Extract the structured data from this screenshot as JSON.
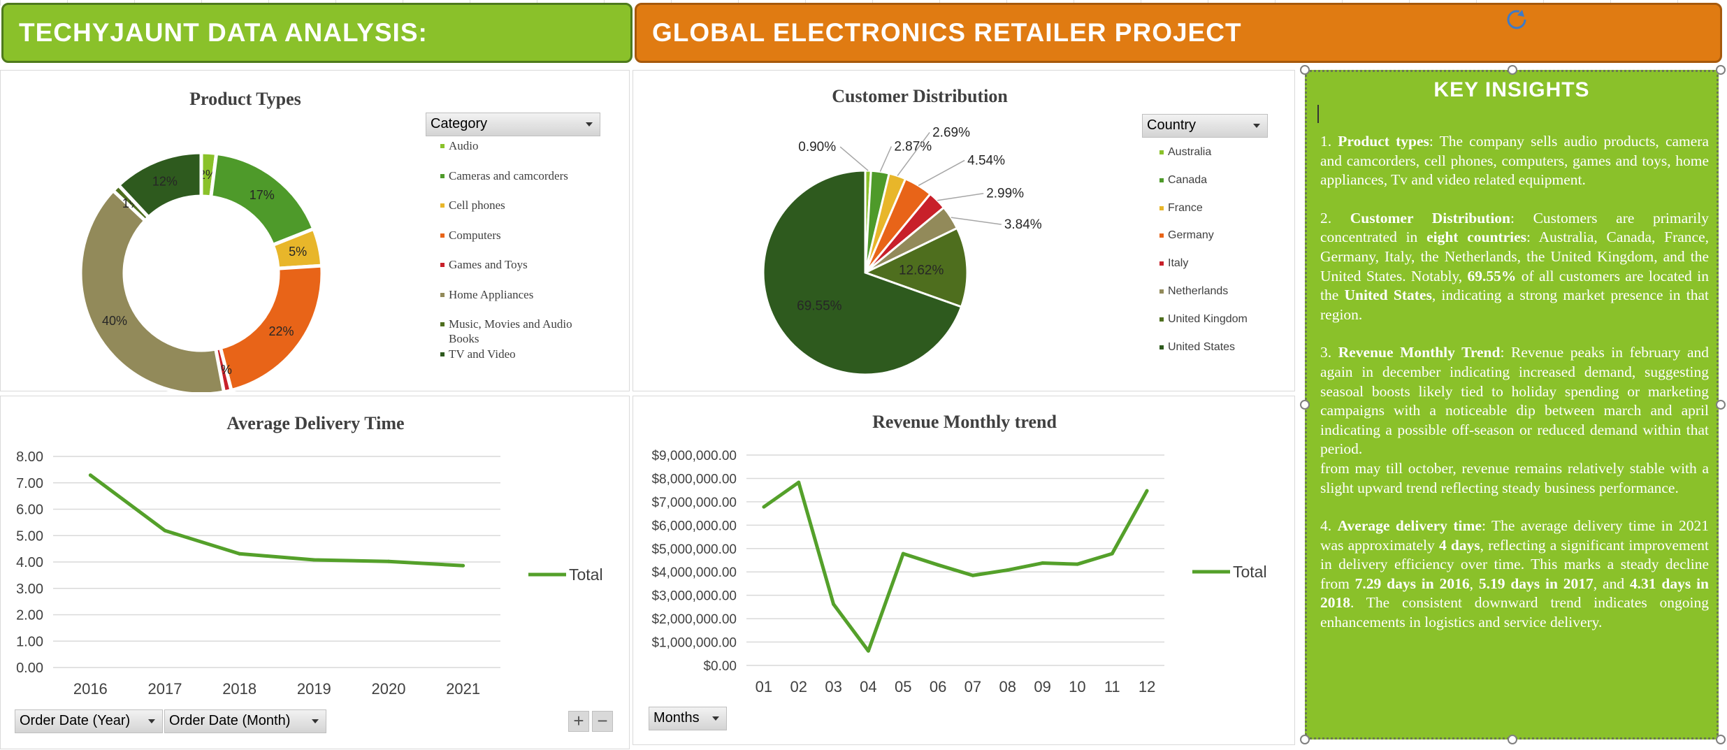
{
  "header": {
    "left_title": "TECHYJAUNT DATA ANALYSIS:",
    "right_title": "GLOBAL ELECTRONICS RETAILER PROJECT"
  },
  "product_types": {
    "title": "Product Types",
    "filter_label": "Category",
    "legend": [
      {
        "label": "Audio",
        "color": "#8ac12a"
      },
      {
        "label": "Cameras and camcorders",
        "color": "#4e9a2a"
      },
      {
        "label": "Cell phones",
        "color": "#e8b62a"
      },
      {
        "label": "Computers",
        "color": "#e86418"
      },
      {
        "label": "Games and Toys",
        "color": "#c8202a"
      },
      {
        "label": "Home Appliances",
        "color": "#928a5a"
      },
      {
        "label": "Music, Movies and Audio Books",
        "color": "#4e6e1e"
      },
      {
        "label": "TV and Video",
        "color": "#2e5a1e"
      }
    ]
  },
  "customer_distribution": {
    "title": "Customer Distribution",
    "filter_label": "Country",
    "legend": [
      {
        "label": "Australia",
        "color": "#8ac12a"
      },
      {
        "label": "Canada",
        "color": "#4e9a2a"
      },
      {
        "label": "France",
        "color": "#e8b62a"
      },
      {
        "label": "Germany",
        "color": "#e86418"
      },
      {
        "label": "Italy",
        "color": "#c8202a"
      },
      {
        "label": "Netherlands",
        "color": "#928a5a"
      },
      {
        "label": "United Kingdom",
        "color": "#4e6e1e"
      },
      {
        "label": "United States",
        "color": "#2e5a1e"
      }
    ]
  },
  "avg_delivery": {
    "title": "Average Delivery Time",
    "legend_label": "Total",
    "filter_year": "Order Date (Year)",
    "filter_month": "Order Date (Month)"
  },
  "revenue": {
    "title": "Revenue Monthly trend",
    "legend_label": "Total",
    "filter_label": "Months"
  },
  "insights": {
    "title": "KEY INSIGHTS",
    "p1_prefix": "1. ",
    "p1_bold": "Product types",
    "p1_text": ": The company sells audio products, camera and camcorders, cell phones, computers, games and toys, home appliances, Tv and video related equipment.",
    "p2_prefix": "2. ",
    "p2_bold": "Customer Distribution",
    "p2_text_a": ": Customers are primarily concentrated in ",
    "p2_bold2": "eight countries",
    "p2_text_b": ": Australia, Canada, France, Germany, Italy, the Netherlands, the United Kingdom, and the United States. Notably, ",
    "p2_bold3": "69.55%",
    "p2_text_c": " of all customers are located in the ",
    "p2_bold4": "United States",
    "p2_text_d": ", indicating a strong market presence in that region.",
    "p3_prefix": "3. ",
    "p3_bold": "Revenue Monthly Trend",
    "p3_text": ": Revenue peaks in february and again in december indicating increased demand, suggesting seasoal boosts likely tied to holiday spending or marketing campaigns with a noticeable dip between march and april indicating a possible off-season or reduced demand within that period.",
    "p3_text2": "from may till october, revenue remains relatively stable with a slight upward trend reflecting steady business performance.",
    "p4_prefix": "4. ",
    "p4_bold": "Average delivery time",
    "p4_text_a": ": The average delivery time in 2021 was approximately ",
    "p4_bold2": "4 days",
    "p4_text_b": ", reflecting a significant improvement in delivery efficiency over time. This marks a steady decline from ",
    "p4_bold3": "7.29 days in 2016",
    "p4_text_c": ", ",
    "p4_bold4": "5.19 days in 2017",
    "p4_text_d": ", and ",
    "p4_bold5": "4.31 days in 2018",
    "p4_text_e": ". The consistent downward trend indicates ongoing enhancements in logistics and service delivery."
  },
  "chart_data": [
    {
      "type": "pie",
      "title": "Product Types",
      "categories": [
        "Audio",
        "Cameras and camcorders",
        "Cell phones",
        "Computers",
        "Games and Toys",
        "Home Appliances",
        "Music, Movies and Audio Books",
        "TV and Video"
      ],
      "values": [
        2,
        17,
        5,
        22,
        1,
        40,
        1,
        12
      ],
      "labels": [
        "2%",
        "17%",
        "5%",
        "22%",
        "1%",
        "40%",
        "1%",
        "12%"
      ],
      "donut": true
    },
    {
      "type": "pie",
      "title": "Customer Distribution",
      "categories": [
        "Australia",
        "Canada",
        "France",
        "Germany",
        "Italy",
        "Netherlands",
        "United Kingdom",
        "United States"
      ],
      "values": [
        0.9,
        2.87,
        2.69,
        4.54,
        2.99,
        3.84,
        12.62,
        69.55
      ],
      "labels": [
        "0.90%",
        "2.87%",
        "2.69%",
        "4.54%",
        "2.99%",
        "3.84%",
        "12.62%",
        "69.55%"
      ]
    },
    {
      "type": "line",
      "title": "Average Delivery Time",
      "x": [
        "2016",
        "2017",
        "2018",
        "2019",
        "2020",
        "2021"
      ],
      "series": [
        {
          "name": "Total",
          "values": [
            7.29,
            5.19,
            4.31,
            4.08,
            4.02,
            3.86
          ]
        }
      ],
      "ylim": [
        0,
        8
      ],
      "yticks": [
        "0.00",
        "1.00",
        "2.00",
        "3.00",
        "4.00",
        "5.00",
        "6.00",
        "7.00",
        "8.00"
      ],
      "grid": true,
      "legend": "right"
    },
    {
      "type": "line",
      "title": "Revenue Monthly trend",
      "x": [
        "01",
        "02",
        "03",
        "04",
        "05",
        "06",
        "07",
        "08",
        "09",
        "10",
        "11",
        "12"
      ],
      "series": [
        {
          "name": "Total",
          "values": [
            6780000,
            7830000,
            2620000,
            620000,
            4780000,
            4300000,
            3850000,
            4080000,
            4380000,
            4330000,
            4780000,
            7470000
          ]
        }
      ],
      "ylim": [
        0,
        9000000
      ],
      "yticks": [
        "$0.00",
        "$1,000,000.00",
        "$2,000,000.00",
        "$3,000,000.00",
        "$4,000,000.00",
        "$5,000,000.00",
        "$6,000,000.00",
        "$7,000,000.00",
        "$8,000,000.00",
        "$9,000,000.00"
      ],
      "grid": true,
      "legend": "right"
    }
  ]
}
